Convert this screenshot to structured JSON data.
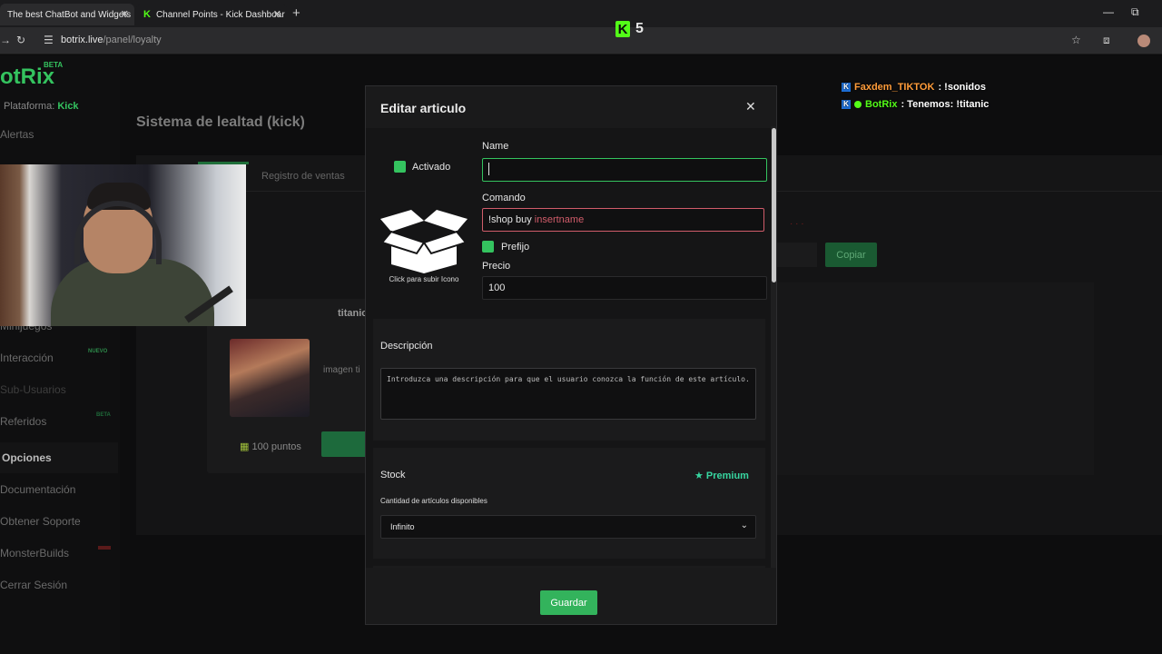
{
  "browser": {
    "tabs": [
      {
        "title": "The best ChatBot and Widgets"
      },
      {
        "title": "Channel Points - Kick Dashboar"
      }
    ],
    "url_host": "botrix.live",
    "url_path": "/panel/loyalty"
  },
  "stream_overlay": {
    "kick_logo": "K",
    "viewer_count": "5",
    "chat": [
      {
        "user": "Faxdem_TIKTOK",
        "message": ": !sonidos"
      },
      {
        "user": "BotRix",
        "message": ": Tenemos: !titanic"
      }
    ]
  },
  "app": {
    "logo_text": "otRix",
    "logo_badge": "BETA",
    "platform_label": "Plataforma:",
    "platform_value": "Kick",
    "page_title": "Sistema de lealtad (kick)",
    "tab_ventas": "Registro de ventas",
    "copy_label": "Copiar",
    "sidebar": {
      "alertas": "Alertas",
      "minijuegos": "Minijuegos",
      "interaccion": "Interacción",
      "interaccion_badge": "NUEVO",
      "subusuarios": "Sub-Usuarios",
      "referidos": "Referidos",
      "referidos_badge": "BETA",
      "opciones": "Opciones",
      "documentacion": "Documentación",
      "soporte": "Obtener Soporte",
      "monsterbuilds": "MonsterBuilds",
      "cerrar": "Cerrar Sesión"
    },
    "card": {
      "title": "titanic",
      "subtitle": "imagen ti",
      "points": "100 puntos"
    }
  },
  "modal": {
    "title": "Editar articulo",
    "activado_label": "Activado",
    "icon_caption": "Click para subir Icono",
    "name_label": "Name",
    "name_value": "",
    "comando_label": "Comando",
    "comando_prefix": "!shop buy ",
    "comando_param": "insertname",
    "prefijo_label": "Prefijo",
    "precio_label": "Precio",
    "precio_value": "100",
    "descripcion_label": "Descripción",
    "descripcion_placeholder": "Introduzca una descripción para que el usuario conozca la función de este artículo.",
    "stock_label": "Stock",
    "premium_label": "Premium",
    "stock_sub": "Cantidad de artículos disponibles",
    "stock_select_value": "Infinito",
    "save_label": "Guardar"
  },
  "colors": {
    "accent_green": "#34c35f",
    "kick_green": "#53fc18",
    "error_red": "#d05c6a",
    "premium": "#37d6a0"
  }
}
